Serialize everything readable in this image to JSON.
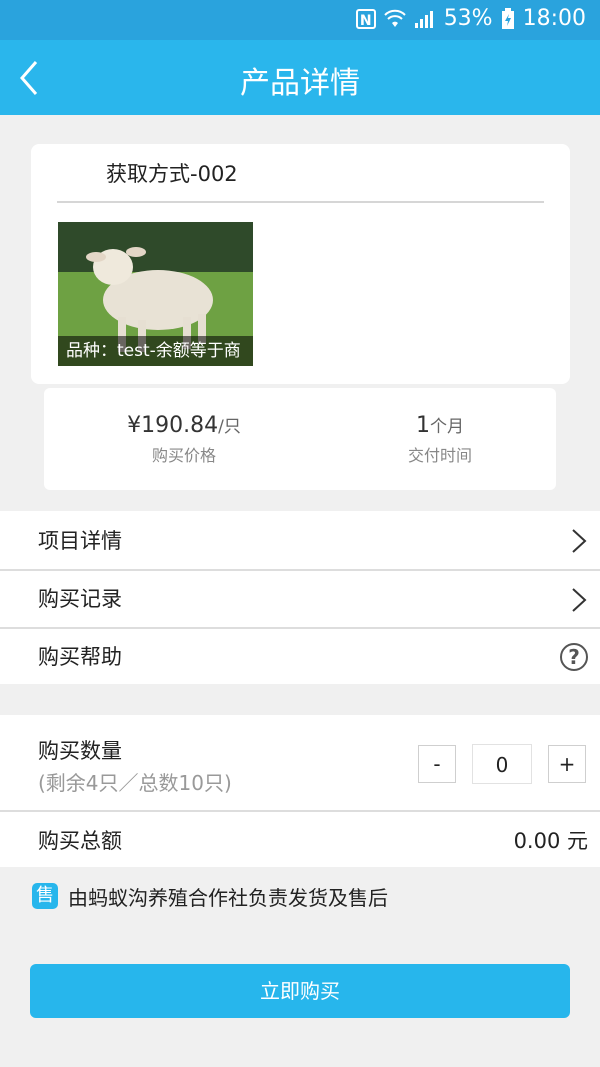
{
  "status_bar": {
    "nfc": "N",
    "battery": "53%",
    "time": "18:00"
  },
  "app_bar": {
    "title": "产品详情"
  },
  "product": {
    "acquisition": "获取方式-002",
    "variety_caption": "品种：test-余额等于商"
  },
  "price_info": {
    "price": "¥190.84",
    "price_unit": "/只",
    "price_label": "购买价格",
    "delivery_value": "1",
    "delivery_unit": "个月",
    "delivery_label": "交付时间"
  },
  "menu": {
    "project_details": "项目详情",
    "purchase_records": "购买记录",
    "purchase_help": "购买帮助",
    "help_symbol": "?"
  },
  "quantity": {
    "label": "购买数量",
    "remaining": "(剩余4只／总数10只)",
    "minus": "-",
    "value": "0",
    "plus": "+"
  },
  "total": {
    "label": "购买总额",
    "value": "0.00 元"
  },
  "seller": {
    "badge": "售",
    "text": "由蚂蚁沟养殖合作社负责发货及售后"
  },
  "actions": {
    "buy_now": "立即购买"
  },
  "colors": {
    "accent": "#27b6ec",
    "status_bar": "#2aa3dd"
  }
}
